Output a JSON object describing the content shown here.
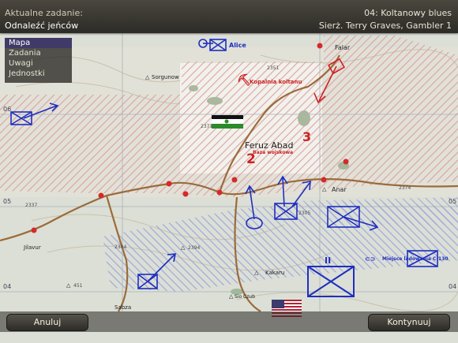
{
  "header": {
    "task_caption": "Aktualne zadanie:",
    "task_name": "Odnaleźć jeńców",
    "mission": "04: Koltanowy blues",
    "player": "Sierż. Terry Graves, Gambler 1"
  },
  "menu": [
    "Mapa",
    "Zadania",
    "Uwagi",
    "Jednostki"
  ],
  "map_labels": {
    "alice": "Alice",
    "falar": "Falar",
    "sorgunow": "Sorgunow",
    "mine": "Kopalnia koltanu",
    "feruz": "Feruz Abad",
    "base": "Baza wojskowa",
    "anar": "Anar",
    "jilavur": "Jilavur",
    "kakaru": "Kakaru",
    "landing": "Miejsce lądowania C-130",
    "sio": "Sio Czub",
    "sabz": "Sabza",
    "num2": "2",
    "num3": "3",
    "grid": [
      "06",
      "05",
      "04",
      "05",
      "04"
    ],
    "heights": [
      "2351",
      "2337",
      "2374",
      "2304",
      "2305",
      "2371",
      "451",
      "2394"
    ]
  },
  "buttons": {
    "cancel": "Anuluj",
    "continue": "Kontynuuj"
  },
  "colors": {
    "enemy": "#cc2222",
    "friendly": "#1e2fbf",
    "header_bg": "#3a3731",
    "menu_active": "#403a68"
  }
}
